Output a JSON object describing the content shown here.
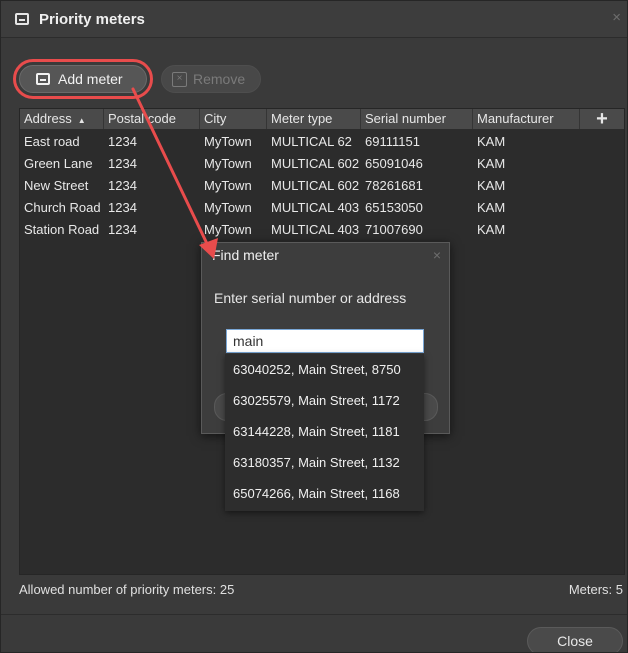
{
  "window": {
    "title": "Priority meters",
    "close_glyph": "×"
  },
  "toolbar": {
    "add_label": "Add meter",
    "remove_label": "Remove"
  },
  "table": {
    "columns": [
      "Address",
      "Postal code",
      "City",
      "Meter type",
      "Serial number",
      "Manufacturer"
    ],
    "sorted_column_indicator": "▲",
    "add_column_glyph": "+",
    "rows": [
      [
        "East road",
        "1234",
        "MyTown",
        "MULTICAL 62",
        "69111151",
        "KAM"
      ],
      [
        "Green Lane",
        "1234",
        "MyTown",
        "MULTICAL 602",
        "65091046",
        "KAM"
      ],
      [
        "New Street",
        "1234",
        "MyTown",
        "MULTICAL 602",
        "78261681",
        "KAM"
      ],
      [
        "Church Road",
        "1234",
        "MyTown",
        "MULTICAL 403",
        "65153050",
        "KAM"
      ],
      [
        "Station Road",
        "1234",
        "MyTown",
        "MULTICAL 403",
        "71007690",
        "KAM"
      ]
    ]
  },
  "status": {
    "allowed": "Allowed number of priority meters: 25",
    "meters": "Meters: 5"
  },
  "footer": {
    "close_label": "Close"
  },
  "dialog": {
    "title": "Find meter",
    "close_glyph": "×",
    "prompt": "Enter serial number or address",
    "input_value": "main",
    "suggestions": [
      "63040252, Main Street, 8750",
      "63025579, Main Street, 1172",
      "63144228, Main Street, 1181",
      "63180357, Main Street, 1132",
      "65074266, Main Street, 1168"
    ]
  },
  "colors": {
    "accent_annotation": "#e84c4c",
    "background": "#3a3a3a",
    "grid_bg": "#2c2c2c"
  },
  "icons": {
    "window": "meter-window-icon",
    "add": "meter-add-icon",
    "remove": "remove-x-icon"
  }
}
